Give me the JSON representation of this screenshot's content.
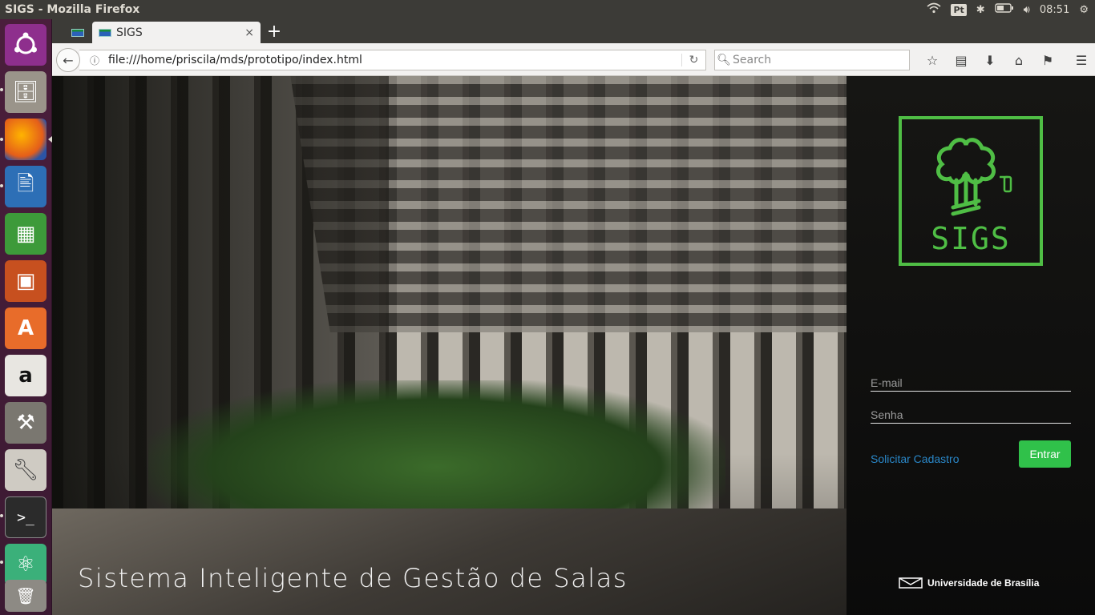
{
  "top_panel": {
    "title": "SIGS - Mozilla Firefox",
    "ime": "Pt",
    "time": "08:51",
    "icons": [
      "wifi-icon",
      "bluetooth-icon",
      "battery-icon",
      "volume-icon",
      "settings-gear-icon"
    ]
  },
  "launcher": {
    "items": [
      "ubuntu-dash",
      "files",
      "firefox",
      "libreoffice-writer",
      "libreoffice-calc",
      "libreoffice-impress",
      "software-center",
      "amazon",
      "system-settings",
      "system-tools",
      "terminal",
      "atom",
      "trash"
    ]
  },
  "browser": {
    "tab_label": "SIGS",
    "new_tab": "+",
    "close": "×",
    "url": "file:///home/priscila/mds/prototipo/index.html",
    "search_placeholder": "Search"
  },
  "page": {
    "tagline": "Sistema Inteligente de Gestão de Salas",
    "logo_text": "SIGS",
    "email_placeholder": "E-mail",
    "password_placeholder": "Senha",
    "register_link": "Solicitar Cadastro",
    "enter_button": "Entrar",
    "footer_logo": "Universidade de Brasília"
  },
  "colors": {
    "accent_green": "#4fbe45",
    "button_green": "#30c14a",
    "link_blue": "#2a88c9",
    "launcher_bg": "#4a1e3c"
  }
}
